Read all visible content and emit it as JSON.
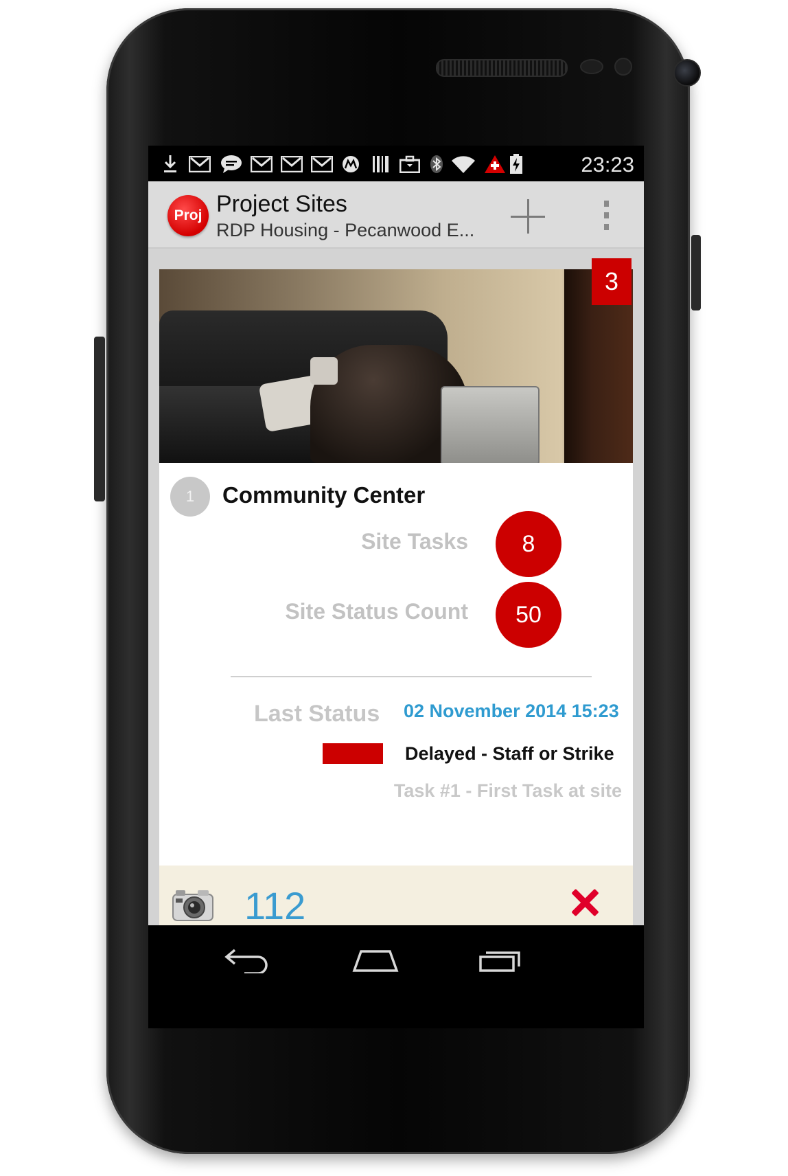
{
  "status_bar": {
    "time": "23:23",
    "icons": [
      "download-icon",
      "gmail-icon",
      "chat-icon",
      "gmail-icon",
      "gmail-icon",
      "gmail-icon",
      "motorola-icon",
      "barcode-icon",
      "briefcase-icon",
      "bluetooth-icon",
      "wifi-icon",
      "alert-icon",
      "battery-charging-icon"
    ]
  },
  "action_bar": {
    "logo_text": "Proj",
    "title": "Project Sites",
    "subtitle": "RDP Housing - Pecanwood E..."
  },
  "site_card": {
    "photo_badge": "3",
    "site_number": "1",
    "site_name": "Community Center",
    "metrics": [
      {
        "label": "Site Tasks",
        "value": "8"
      },
      {
        "label": "Site Status Count",
        "value": "50"
      }
    ],
    "last_status": {
      "label": "Last Status",
      "date": "02 November 2014 15:23",
      "status": "Delayed - Staff or Strike",
      "status_color": "#cc0000",
      "task": "Task #1 - First Task at site"
    },
    "footer": {
      "photo_count": "112"
    }
  },
  "colors": {
    "accent_red": "#cc0000",
    "link_blue": "#2f9bd0",
    "footer_bg": "#f4efe0"
  }
}
